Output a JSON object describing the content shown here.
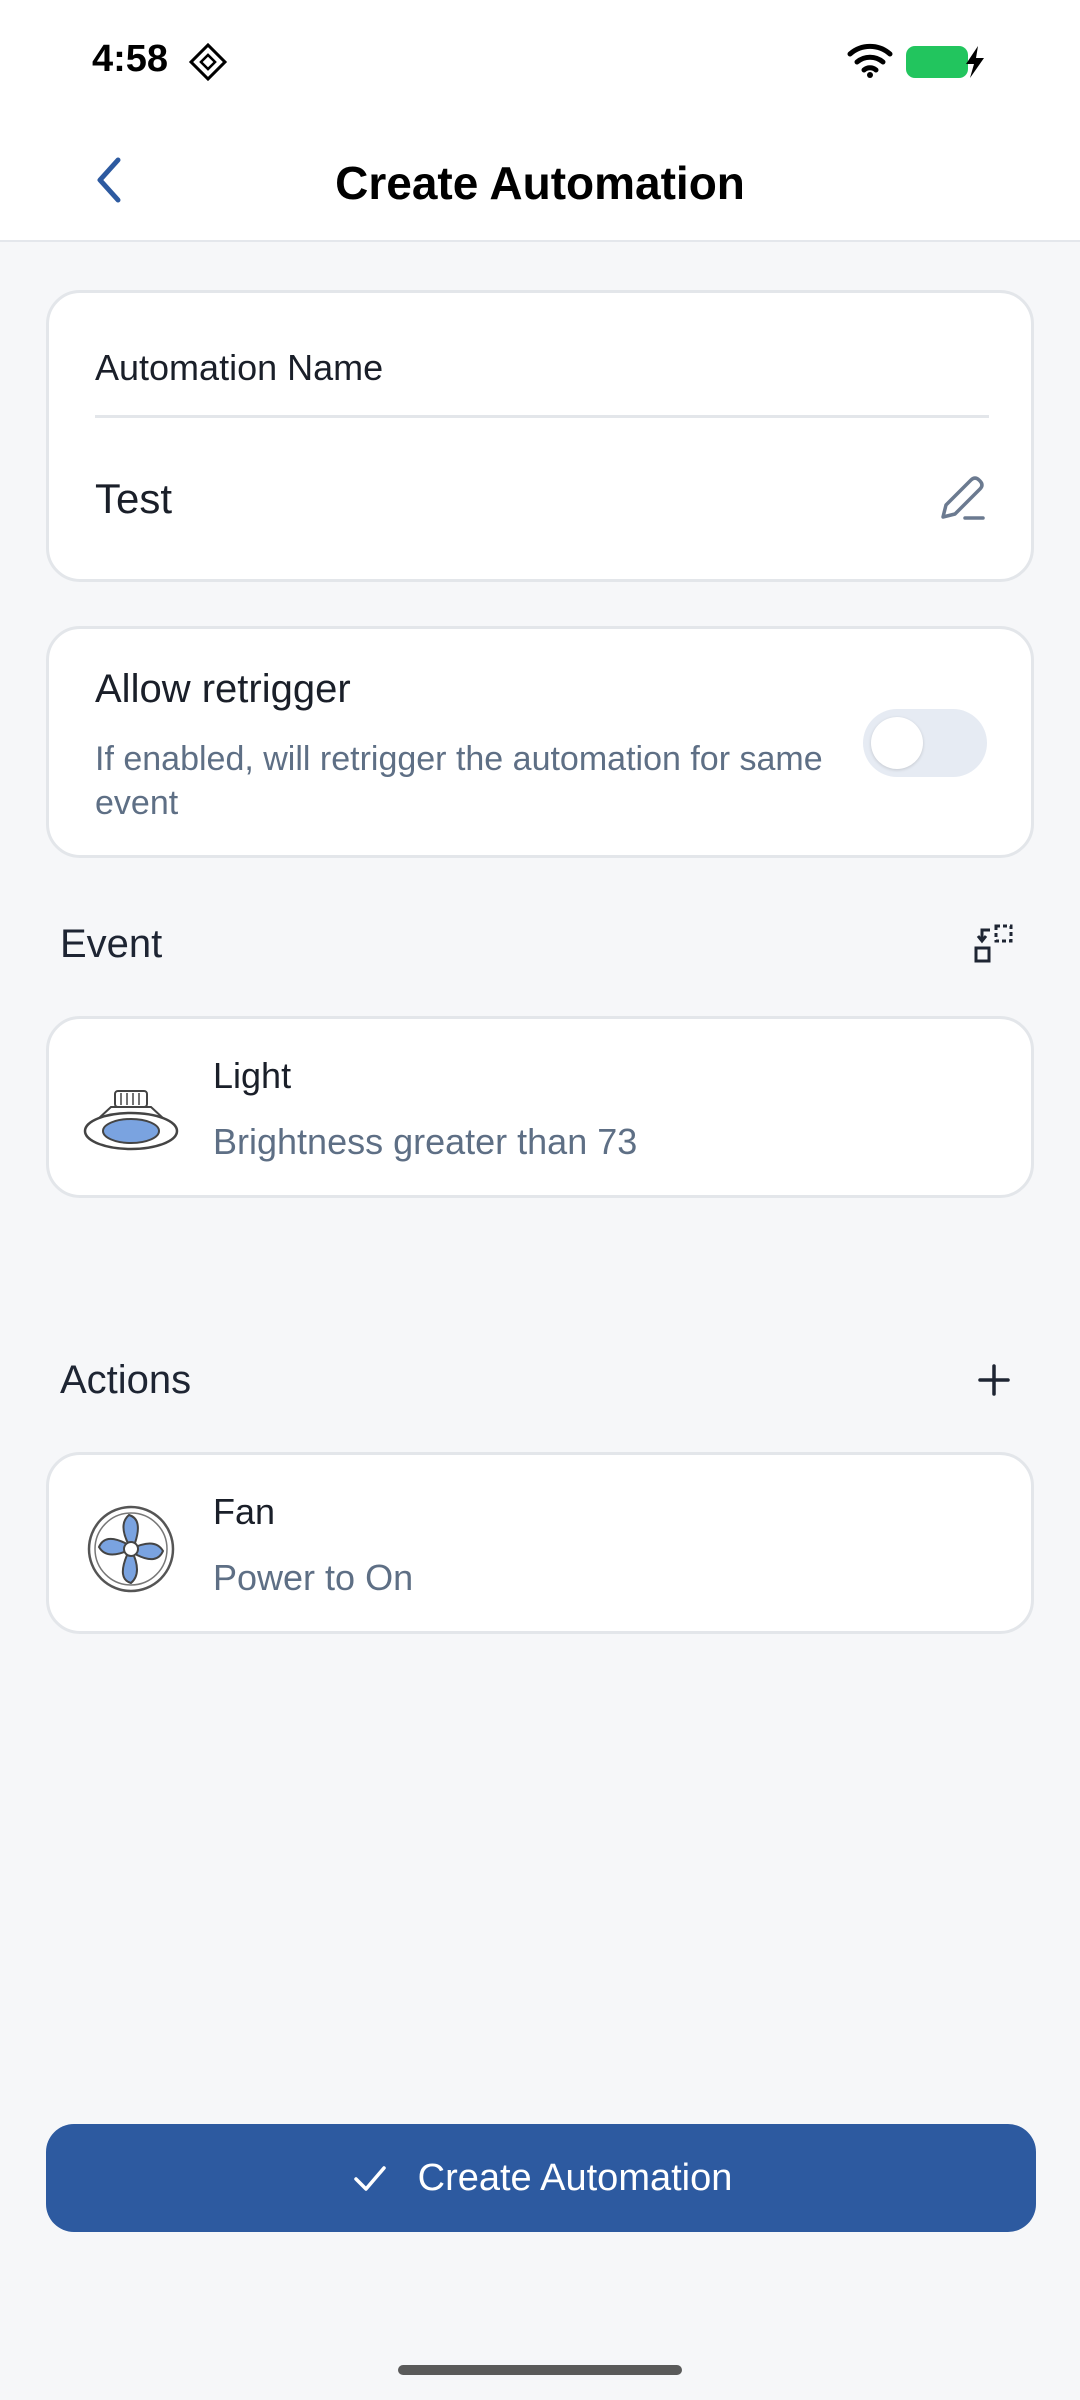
{
  "status_bar": {
    "time": "4:58"
  },
  "header": {
    "title": "Create Automation"
  },
  "name_card": {
    "label": "Automation Name",
    "value": "Test"
  },
  "retrigger": {
    "title": "Allow retrigger",
    "description": "If enabled, will retrigger the automation for same event",
    "enabled": false
  },
  "event_section": {
    "title": "Event",
    "item": {
      "name": "Light",
      "description": "Brightness greater than 73",
      "icon": "light-icon"
    }
  },
  "actions_section": {
    "title": "Actions",
    "item": {
      "name": "Fan",
      "description": "Power to On",
      "icon": "fan-icon"
    }
  },
  "footer": {
    "create_label": "Create Automation"
  },
  "colors": {
    "primary": "#2d5aa0",
    "background": "#f6f7f9",
    "muted_text": "#5e6f85",
    "battery": "#22c55e"
  }
}
